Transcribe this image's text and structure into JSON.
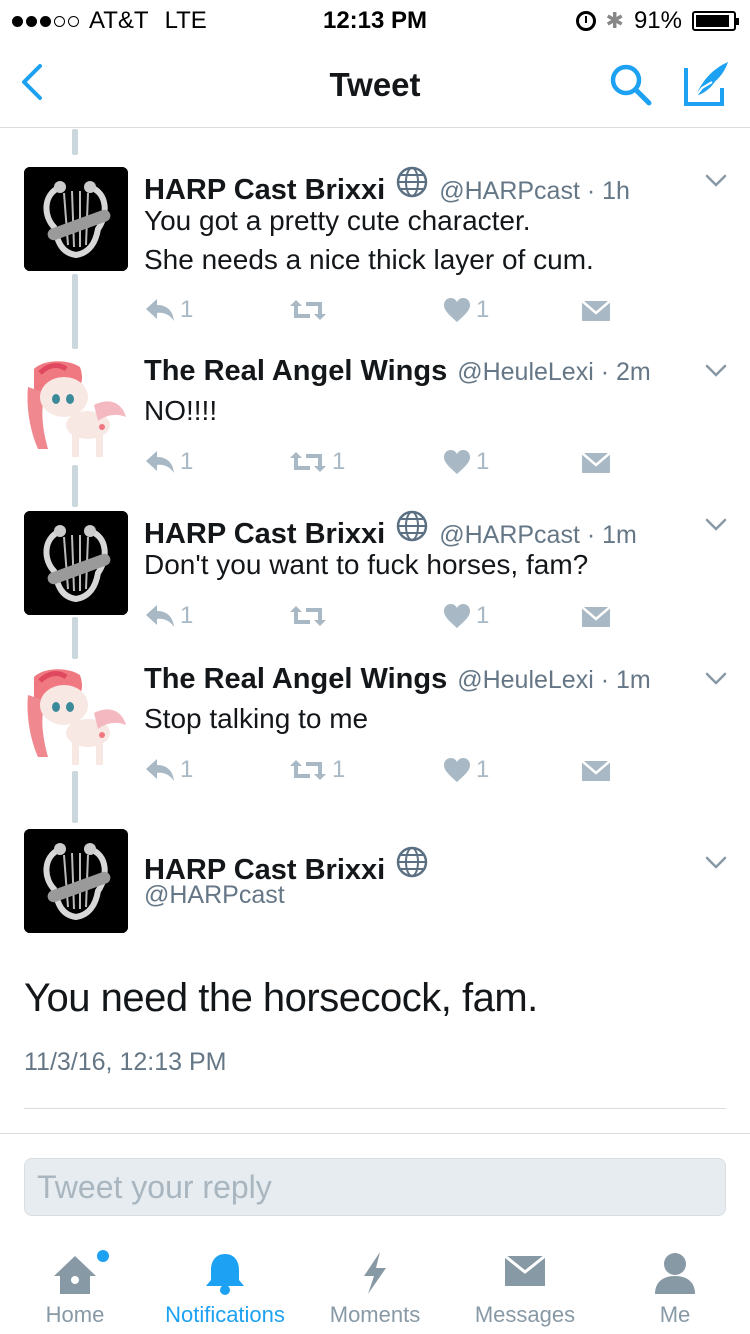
{
  "status_bar": {
    "carrier": "AT&T",
    "network": "LTE",
    "time": "12:13 PM",
    "battery": "91%",
    "battery_level": 0.91,
    "signal_bars": 3
  },
  "nav": {
    "title": "Tweet"
  },
  "tweets": [
    {
      "name": "HARP Cast Brixxi",
      "handle": "@HARPcast",
      "time": "1h",
      "text_lines": [
        "You got a pretty cute character.",
        "She needs a nice thick layer of cum."
      ],
      "replies": "1",
      "retweets": "",
      "likes": "1"
    },
    {
      "name": "The Real Angel Wings",
      "handle": "@HeuleLexi",
      "time": "2m",
      "text_lines": [
        "NO!!!!"
      ],
      "replies": "1",
      "retweets": "1",
      "likes": "1"
    },
    {
      "name": "HARP Cast Brixxi",
      "handle": "@HARPcast",
      "time": "1m",
      "text_lines": [
        "Don't you want to fuck horses, fam?"
      ],
      "replies": "1",
      "retweets": "",
      "likes": "1"
    },
    {
      "name": "The Real Angel Wings",
      "handle": "@HeuleLexi",
      "time": "1m",
      "text_lines": [
        "Stop talking to me"
      ],
      "replies": "1",
      "retweets": "1",
      "likes": "1"
    }
  ],
  "main_tweet": {
    "name": "HARP Cast Brixxi",
    "handle": "@HARPcast",
    "text": "You need the horsecock, fam.",
    "date": "11/3/16, 12:13 PM"
  },
  "reply": {
    "placeholder": "Tweet your reply"
  },
  "tabs": [
    {
      "label": "Home",
      "icon": "home-icon"
    },
    {
      "label": "Notifications",
      "icon": "bell-icon",
      "active": true
    },
    {
      "label": "Moments",
      "icon": "lightning-icon"
    },
    {
      "label": "Messages",
      "icon": "envelope-icon"
    },
    {
      "label": "Me",
      "icon": "person-icon"
    }
  ],
  "colors": {
    "accent": "#1da1f2",
    "secondary_text": "#657786",
    "action_icon": "#a8b8c4"
  }
}
